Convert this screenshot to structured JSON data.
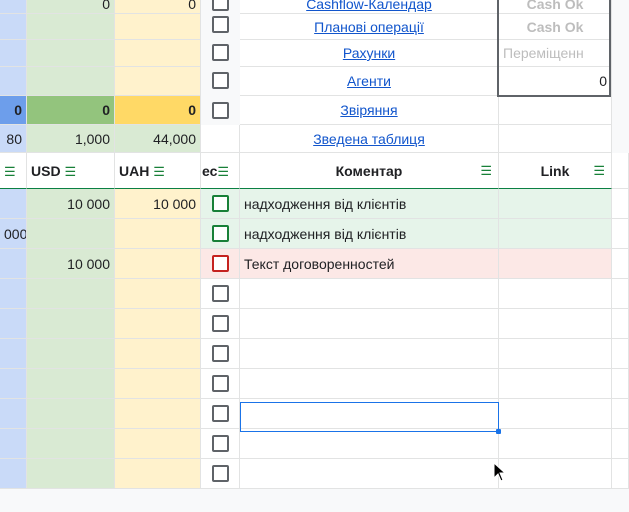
{
  "top_rows": {
    "row0": {
      "usd": "0",
      "uah": "0",
      "link": "Cashflow-Календар",
      "status": "Cash Ok"
    },
    "row1": {
      "link": "Планові операції",
      "status": "Cash Ok"
    },
    "row2": {
      "link": "Рахунки",
      "status": "Переміщенн"
    },
    "row3": {
      "link": "Агенти",
      "status": "0"
    },
    "row4": {
      "usd": "0",
      "uah": "0",
      "first": "0",
      "link": "Звіряння"
    },
    "row5": {
      "first": "80",
      "usd": "1,000",
      "uah": "44,000",
      "link": "Зведена таблиця"
    }
  },
  "header": {
    "usd": "USD",
    "uah": "UAH",
    "status": "ес",
    "comment": "Коментар",
    "link": "Link",
    "filter_icon": "filter-icon"
  },
  "rows": [
    {
      "first": "",
      "usd": "10 000",
      "uah": "10 000",
      "check": "green",
      "comment": "надходження від клієнтів"
    },
    {
      "first": "000",
      "usd": "",
      "uah": "",
      "check": "green",
      "comment": "надходження від клієнтів"
    },
    {
      "first": "",
      "usd": "10 000",
      "uah": "",
      "check": "red",
      "comment": "Текст договоренностей"
    },
    {
      "first": "",
      "usd": "",
      "uah": "",
      "check": "gray",
      "comment": ""
    },
    {
      "first": "",
      "usd": "",
      "uah": "",
      "check": "gray",
      "comment": ""
    },
    {
      "first": "",
      "usd": "",
      "uah": "",
      "check": "gray",
      "comment": ""
    },
    {
      "first": "",
      "usd": "",
      "uah": "",
      "check": "gray",
      "comment": ""
    },
    {
      "first": "",
      "usd": "",
      "uah": "",
      "check": "gray",
      "comment": ""
    },
    {
      "first": "",
      "usd": "",
      "uah": "",
      "check": "gray",
      "comment": ""
    },
    {
      "first": "",
      "usd": "",
      "uah": "",
      "check": "gray",
      "comment": ""
    }
  ],
  "colors": {
    "blue": "#c9daf8",
    "green": "#d9ead3",
    "yellow": "#fff2cc",
    "accent": "#188038",
    "selection": "#1a73e8"
  }
}
